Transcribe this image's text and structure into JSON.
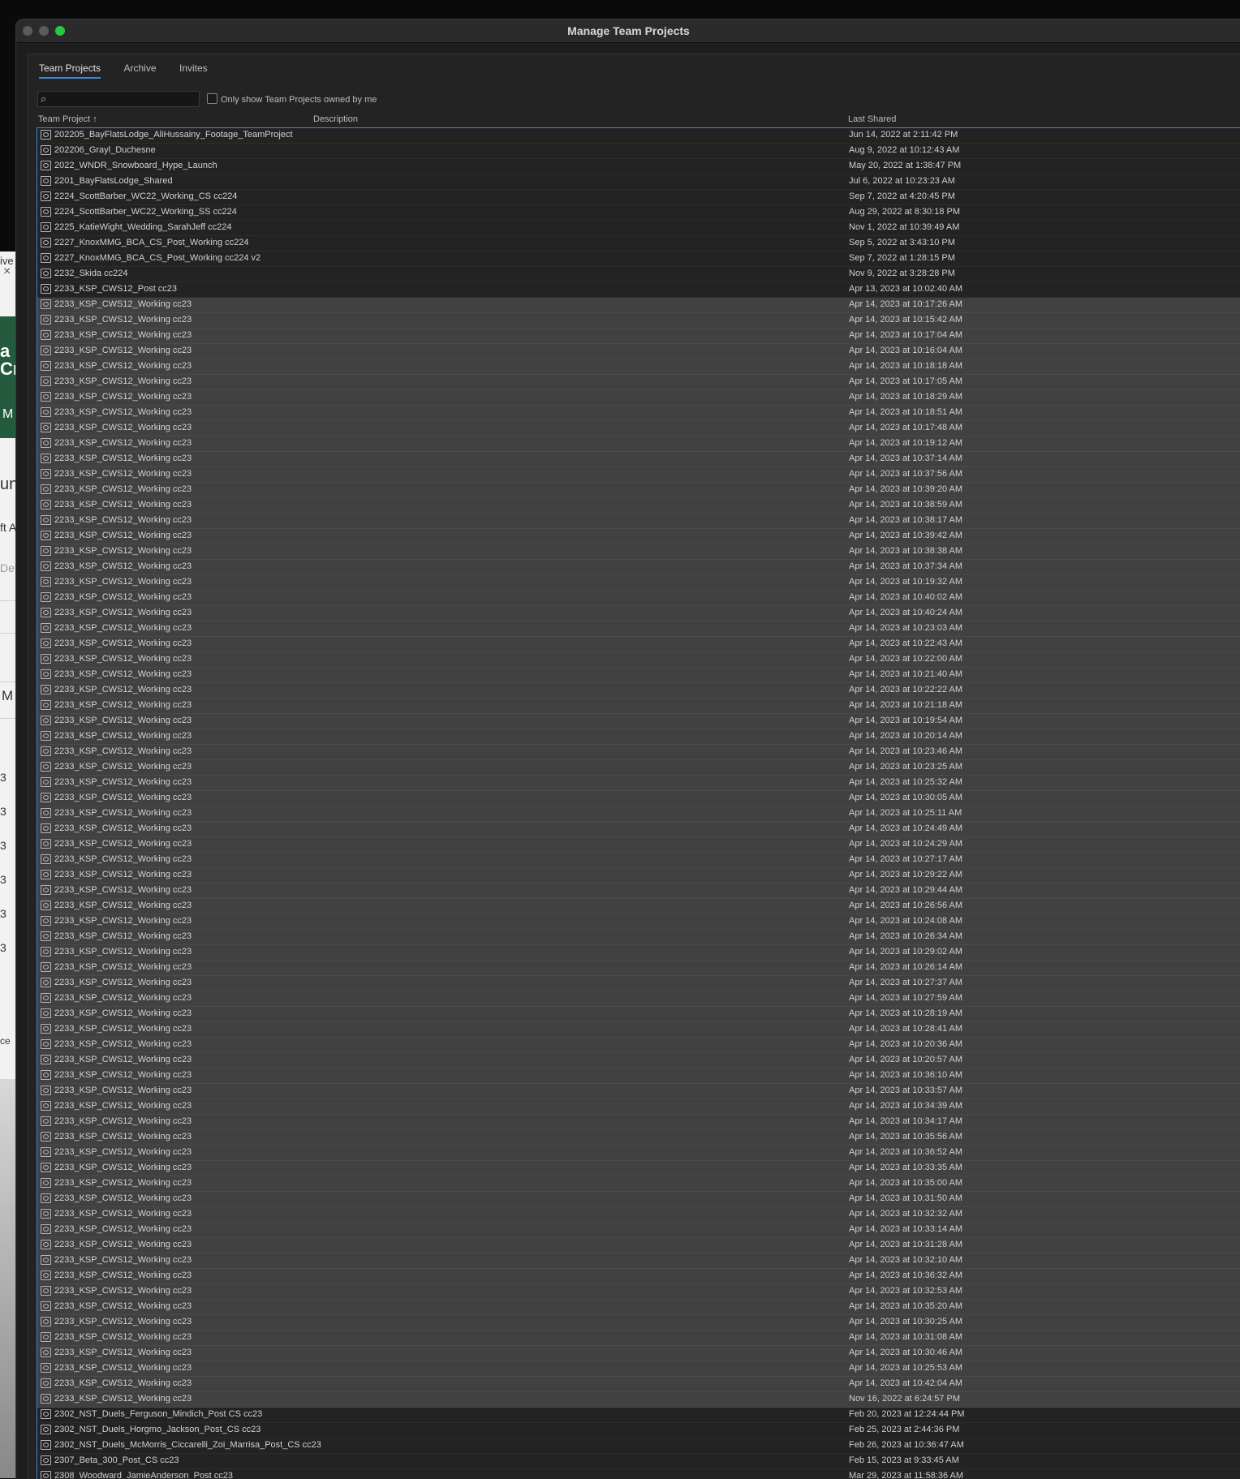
{
  "window": {
    "title": "Manage Team Projects"
  },
  "tabs": [
    {
      "label": "Team Projects",
      "active": true
    },
    {
      "label": "Archive",
      "active": false
    },
    {
      "label": "Invites",
      "active": false
    }
  ],
  "search": {
    "value": "",
    "placeholder": ""
  },
  "filter": {
    "label": "Only show Team Projects owned by me",
    "checked": false
  },
  "columns": {
    "team_project": "Team Project",
    "sort_arrow": "↑",
    "description": "Description",
    "last_shared": "Last Shared"
  },
  "background_app": {
    "fragments": [
      "ive",
      "a",
      "Cr",
      "M",
      "un",
      "ft A",
      "Det",
      "M",
      "3",
      "3",
      "3",
      "3",
      "3",
      "3",
      "ce"
    ]
  },
  "rows": [
    {
      "name": "202205_BayFlatsLodge_AliHussainy_Footage_TeamProject",
      "date": "Jun 14, 2022 at 2:11:42 PM",
      "selected": false
    },
    {
      "name": "202206_Grayl_Duchesne",
      "date": "Aug 9, 2022 at 10:12:43 AM",
      "selected": false
    },
    {
      "name": "2022_WNDR_Snowboard_Hype_Launch",
      "date": "May 20, 2022 at 1:38:47 PM",
      "selected": false
    },
    {
      "name": "2201_BayFlatsLodge_Shared",
      "date": "Jul 6, 2022 at 10:23:23 AM",
      "selected": false
    },
    {
      "name": "2224_ScottBarber_WC22_Working_CS cc224",
      "date": "Sep 7, 2022 at 4:20:45 PM",
      "selected": false
    },
    {
      "name": "2224_ScottBarber_WC22_Working_SS cc224",
      "date": "Aug 29, 2022 at 8:30:18 PM",
      "selected": false
    },
    {
      "name": "2225_KatieWight_Wedding_SarahJeff cc224",
      "date": "Nov 1, 2022 at 10:39:49 AM",
      "selected": false
    },
    {
      "name": "2227_KnoxMMG_BCA_CS_Post_Working cc224",
      "date": "Sep 5, 2022 at 3:43:10 PM",
      "selected": false
    },
    {
      "name": "2227_KnoxMMG_BCA_CS_Post_Working cc224 v2",
      "date": "Sep 7, 2022 at 1:28:15 PM",
      "selected": false
    },
    {
      "name": "2232_Skida cc224",
      "date": "Nov 9, 2022 at 3:28:28 PM",
      "selected": false
    },
    {
      "name": "2233_KSP_CWS12_Post cc23",
      "date": "Apr 13, 2023 at 10:02:40 AM",
      "selected": false
    },
    {
      "name": "2233_KSP_CWS12_Working cc23",
      "date": "Apr 14, 2023 at 10:17:26 AM",
      "selected": true
    },
    {
      "name": "2233_KSP_CWS12_Working cc23",
      "date": "Apr 14, 2023 at 10:15:42 AM",
      "selected": true
    },
    {
      "name": "2233_KSP_CWS12_Working cc23",
      "date": "Apr 14, 2023 at 10:17:04 AM",
      "selected": true
    },
    {
      "name": "2233_KSP_CWS12_Working cc23",
      "date": "Apr 14, 2023 at 10:16:04 AM",
      "selected": true
    },
    {
      "name": "2233_KSP_CWS12_Working cc23",
      "date": "Apr 14, 2023 at 10:18:18 AM",
      "selected": true
    },
    {
      "name": "2233_KSP_CWS12_Working cc23",
      "date": "Apr 14, 2023 at 10:17:05 AM",
      "selected": true
    },
    {
      "name": "2233_KSP_CWS12_Working cc23",
      "date": "Apr 14, 2023 at 10:18:29 AM",
      "selected": true
    },
    {
      "name": "2233_KSP_CWS12_Working cc23",
      "date": "Apr 14, 2023 at 10:18:51 AM",
      "selected": true
    },
    {
      "name": "2233_KSP_CWS12_Working cc23",
      "date": "Apr 14, 2023 at 10:17:48 AM",
      "selected": true
    },
    {
      "name": "2233_KSP_CWS12_Working cc23",
      "date": "Apr 14, 2023 at 10:19:12 AM",
      "selected": true
    },
    {
      "name": "2233_KSP_CWS12_Working cc23",
      "date": "Apr 14, 2023 at 10:37:14 AM",
      "selected": true
    },
    {
      "name": "2233_KSP_CWS12_Working cc23",
      "date": "Apr 14, 2023 at 10:37:56 AM",
      "selected": true
    },
    {
      "name": "2233_KSP_CWS12_Working cc23",
      "date": "Apr 14, 2023 at 10:39:20 AM",
      "selected": true
    },
    {
      "name": "2233_KSP_CWS12_Working cc23",
      "date": "Apr 14, 2023 at 10:38:59 AM",
      "selected": true
    },
    {
      "name": "2233_KSP_CWS12_Working cc23",
      "date": "Apr 14, 2023 at 10:38:17 AM",
      "selected": true
    },
    {
      "name": "2233_KSP_CWS12_Working cc23",
      "date": "Apr 14, 2023 at 10:39:42 AM",
      "selected": true
    },
    {
      "name": "2233_KSP_CWS12_Working cc23",
      "date": "Apr 14, 2023 at 10:38:38 AM",
      "selected": true
    },
    {
      "name": "2233_KSP_CWS12_Working cc23",
      "date": "Apr 14, 2023 at 10:37:34 AM",
      "selected": true
    },
    {
      "name": "2233_KSP_CWS12_Working cc23",
      "date": "Apr 14, 2023 at 10:19:32 AM",
      "selected": true
    },
    {
      "name": "2233_KSP_CWS12_Working cc23",
      "date": "Apr 14, 2023 at 10:40:02 AM",
      "selected": true
    },
    {
      "name": "2233_KSP_CWS12_Working cc23",
      "date": "Apr 14, 2023 at 10:40:24 AM",
      "selected": true
    },
    {
      "name": "2233_KSP_CWS12_Working cc23",
      "date": "Apr 14, 2023 at 10:23:03 AM",
      "selected": true
    },
    {
      "name": "2233_KSP_CWS12_Working cc23",
      "date": "Apr 14, 2023 at 10:22:43 AM",
      "selected": true
    },
    {
      "name": "2233_KSP_CWS12_Working cc23",
      "date": "Apr 14, 2023 at 10:22:00 AM",
      "selected": true
    },
    {
      "name": "2233_KSP_CWS12_Working cc23",
      "date": "Apr 14, 2023 at 10:21:40 AM",
      "selected": true
    },
    {
      "name": "2233_KSP_CWS12_Working cc23",
      "date": "Apr 14, 2023 at 10:22:22 AM",
      "selected": true
    },
    {
      "name": "2233_KSP_CWS12_Working cc23",
      "date": "Apr 14, 2023 at 10:21:18 AM",
      "selected": true
    },
    {
      "name": "2233_KSP_CWS12_Working cc23",
      "date": "Apr 14, 2023 at 10:19:54 AM",
      "selected": true
    },
    {
      "name": "2233_KSP_CWS12_Working cc23",
      "date": "Apr 14, 2023 at 10:20:14 AM",
      "selected": true
    },
    {
      "name": "2233_KSP_CWS12_Working cc23",
      "date": "Apr 14, 2023 at 10:23:46 AM",
      "selected": true
    },
    {
      "name": "2233_KSP_CWS12_Working cc23",
      "date": "Apr 14, 2023 at 10:23:25 AM",
      "selected": true
    },
    {
      "name": "2233_KSP_CWS12_Working cc23",
      "date": "Apr 14, 2023 at 10:25:32 AM",
      "selected": true
    },
    {
      "name": "2233_KSP_CWS12_Working cc23",
      "date": "Apr 14, 2023 at 10:30:05 AM",
      "selected": true
    },
    {
      "name": "2233_KSP_CWS12_Working cc23",
      "date": "Apr 14, 2023 at 10:25:11 AM",
      "selected": true
    },
    {
      "name": "2233_KSP_CWS12_Working cc23",
      "date": "Apr 14, 2023 at 10:24:49 AM",
      "selected": true
    },
    {
      "name": "2233_KSP_CWS12_Working cc23",
      "date": "Apr 14, 2023 at 10:24:29 AM",
      "selected": true
    },
    {
      "name": "2233_KSP_CWS12_Working cc23",
      "date": "Apr 14, 2023 at 10:27:17 AM",
      "selected": true
    },
    {
      "name": "2233_KSP_CWS12_Working cc23",
      "date": "Apr 14, 2023 at 10:29:22 AM",
      "selected": true
    },
    {
      "name": "2233_KSP_CWS12_Working cc23",
      "date": "Apr 14, 2023 at 10:29:44 AM",
      "selected": true
    },
    {
      "name": "2233_KSP_CWS12_Working cc23",
      "date": "Apr 14, 2023 at 10:26:56 AM",
      "selected": true
    },
    {
      "name": "2233_KSP_CWS12_Working cc23",
      "date": "Apr 14, 2023 at 10:24:08 AM",
      "selected": true
    },
    {
      "name": "2233_KSP_CWS12_Working cc23",
      "date": "Apr 14, 2023 at 10:26:34 AM",
      "selected": true
    },
    {
      "name": "2233_KSP_CWS12_Working cc23",
      "date": "Apr 14, 2023 at 10:29:02 AM",
      "selected": true
    },
    {
      "name": "2233_KSP_CWS12_Working cc23",
      "date": "Apr 14, 2023 at 10:26:14 AM",
      "selected": true
    },
    {
      "name": "2233_KSP_CWS12_Working cc23",
      "date": "Apr 14, 2023 at 10:27:37 AM",
      "selected": true
    },
    {
      "name": "2233_KSP_CWS12_Working cc23",
      "date": "Apr 14, 2023 at 10:27:59 AM",
      "selected": true
    },
    {
      "name": "2233_KSP_CWS12_Working cc23",
      "date": "Apr 14, 2023 at 10:28:19 AM",
      "selected": true
    },
    {
      "name": "2233_KSP_CWS12_Working cc23",
      "date": "Apr 14, 2023 at 10:28:41 AM",
      "selected": true
    },
    {
      "name": "2233_KSP_CWS12_Working cc23",
      "date": "Apr 14, 2023 at 10:20:36 AM",
      "selected": true
    },
    {
      "name": "2233_KSP_CWS12_Working cc23",
      "date": "Apr 14, 2023 at 10:20:57 AM",
      "selected": true
    },
    {
      "name": "2233_KSP_CWS12_Working cc23",
      "date": "Apr 14, 2023 at 10:36:10 AM",
      "selected": true
    },
    {
      "name": "2233_KSP_CWS12_Working cc23",
      "date": "Apr 14, 2023 at 10:33:57 AM",
      "selected": true
    },
    {
      "name": "2233_KSP_CWS12_Working cc23",
      "date": "Apr 14, 2023 at 10:34:39 AM",
      "selected": true
    },
    {
      "name": "2233_KSP_CWS12_Working cc23",
      "date": "Apr 14, 2023 at 10:34:17 AM",
      "selected": true
    },
    {
      "name": "2233_KSP_CWS12_Working cc23",
      "date": "Apr 14, 2023 at 10:35:56 AM",
      "selected": true
    },
    {
      "name": "2233_KSP_CWS12_Working cc23",
      "date": "Apr 14, 2023 at 10:36:52 AM",
      "selected": true
    },
    {
      "name": "2233_KSP_CWS12_Working cc23",
      "date": "Apr 14, 2023 at 10:33:35 AM",
      "selected": true
    },
    {
      "name": "2233_KSP_CWS12_Working cc23",
      "date": "Apr 14, 2023 at 10:35:00 AM",
      "selected": true
    },
    {
      "name": "2233_KSP_CWS12_Working cc23",
      "date": "Apr 14, 2023 at 10:31:50 AM",
      "selected": true
    },
    {
      "name": "2233_KSP_CWS12_Working cc23",
      "date": "Apr 14, 2023 at 10:32:32 AM",
      "selected": true
    },
    {
      "name": "2233_KSP_CWS12_Working cc23",
      "date": "Apr 14, 2023 at 10:33:14 AM",
      "selected": true
    },
    {
      "name": "2233_KSP_CWS12_Working cc23",
      "date": "Apr 14, 2023 at 10:31:28 AM",
      "selected": true
    },
    {
      "name": "2233_KSP_CWS12_Working cc23",
      "date": "Apr 14, 2023 at 10:32:10 AM",
      "selected": true
    },
    {
      "name": "2233_KSP_CWS12_Working cc23",
      "date": "Apr 14, 2023 at 10:36:32 AM",
      "selected": true
    },
    {
      "name": "2233_KSP_CWS12_Working cc23",
      "date": "Apr 14, 2023 at 10:32:53 AM",
      "selected": true
    },
    {
      "name": "2233_KSP_CWS12_Working cc23",
      "date": "Apr 14, 2023 at 10:35:20 AM",
      "selected": true
    },
    {
      "name": "2233_KSP_CWS12_Working cc23",
      "date": "Apr 14, 2023 at 10:30:25 AM",
      "selected": true
    },
    {
      "name": "2233_KSP_CWS12_Working cc23",
      "date": "Apr 14, 2023 at 10:31:08 AM",
      "selected": true
    },
    {
      "name": "2233_KSP_CWS12_Working cc23",
      "date": "Apr 14, 2023 at 10:30:46 AM",
      "selected": true
    },
    {
      "name": "2233_KSP_CWS12_Working cc23",
      "date": "Apr 14, 2023 at 10:25:53 AM",
      "selected": true
    },
    {
      "name": "2233_KSP_CWS12_Working cc23",
      "date": "Apr 14, 2023 at 10:42:04 AM",
      "selected": true
    },
    {
      "name": "2233_KSP_CWS12_Working cc23",
      "date": "Nov 16, 2022 at 6:24:57 PM",
      "selected": true
    },
    {
      "name": "2302_NST_Duels_Ferguson_Mindich_Post CS cc23",
      "date": "Feb 20, 2023 at 12:24:44 PM",
      "selected": false
    },
    {
      "name": "2302_NST_Duels_Horgmo_Jackson_Post_CS cc23",
      "date": "Feb 25, 2023 at 2:44:36 PM",
      "selected": false
    },
    {
      "name": "2302_NST_Duels_McMorris_Ciccarelli_Zoi_Marrisa_Post_CS cc23",
      "date": "Feb 26, 2023 at 10:36:47 AM",
      "selected": false
    },
    {
      "name": "2307_Beta_300_Post_CS cc23",
      "date": "Feb 15, 2023 at 9:33:45 AM",
      "selected": false
    },
    {
      "name": "2308_Woodward_JamieAnderson_Post cc23",
      "date": "Mar 29, 2023 at 11:58:36 AM",
      "selected": false
    }
  ]
}
